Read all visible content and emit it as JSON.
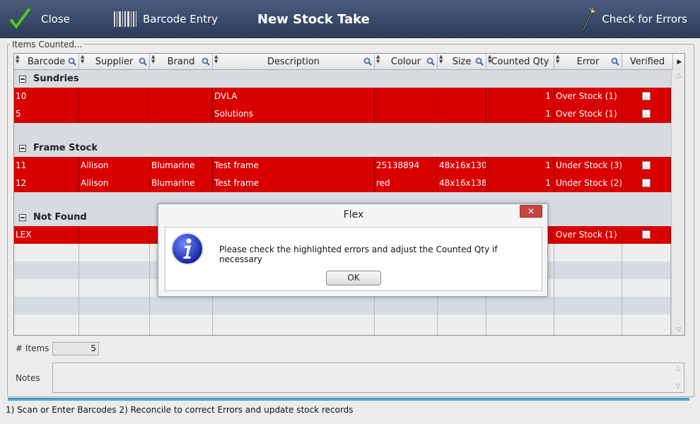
{
  "toolbar": {
    "close_label": "Close",
    "barcode_label": "Barcode Entry",
    "title": "New Stock Take",
    "check_label": "Check for Errors"
  },
  "section_label": "Items Counted...",
  "columns": [
    "Barcode",
    "Supplier",
    "Brand",
    "Description",
    "Colour",
    "Size",
    "Counted Qty",
    "Error",
    "Verified"
  ],
  "groups": [
    {
      "name": "Sundries",
      "rows": [
        {
          "barcode": "10",
          "supplier": "",
          "brand": "",
          "description": "DVLA",
          "colour": "",
          "size": "",
          "qty": "1",
          "error": "Over Stock (1)"
        },
        {
          "barcode": "5",
          "supplier": "",
          "brand": "",
          "description": "Solutions",
          "colour": "",
          "size": "",
          "qty": "1",
          "error": "Over Stock (1)"
        }
      ]
    },
    {
      "name": "Frame Stock",
      "rows": [
        {
          "barcode": "11",
          "supplier": "Allison",
          "brand": "Blumarine",
          "description": "Test frame",
          "colour": "25138894",
          "size": "48x16x130",
          "qty": "1",
          "error": "Under Stock (3)"
        },
        {
          "barcode": "12",
          "supplier": "Allison",
          "brand": "Blumarine",
          "description": "Test frame",
          "colour": "red",
          "size": "48x16x138",
          "qty": "1",
          "error": "Under Stock (2)"
        }
      ]
    },
    {
      "name": "Not Found",
      "rows": [
        {
          "barcode": "LEX",
          "supplier": "",
          "brand": "",
          "description": "",
          "colour": "",
          "size": "",
          "qty": "",
          "error": "Over Stock (1)"
        }
      ]
    }
  ],
  "footer": {
    "items_label": "# Items",
    "items_value": "5",
    "notes_label": "Notes",
    "status": "1) Scan or Enter Barcodes  2) Reconcile to correct Errors and update stock records"
  },
  "dialog": {
    "title": "Flex",
    "close": "✕",
    "message": "Please check the highlighted errors and adjust the Counted Qty if necessary",
    "ok": "OK"
  },
  "colors": {
    "error_row": "#d90000",
    "toolbar": "#3a4868",
    "accent": "#4ba9c8"
  }
}
